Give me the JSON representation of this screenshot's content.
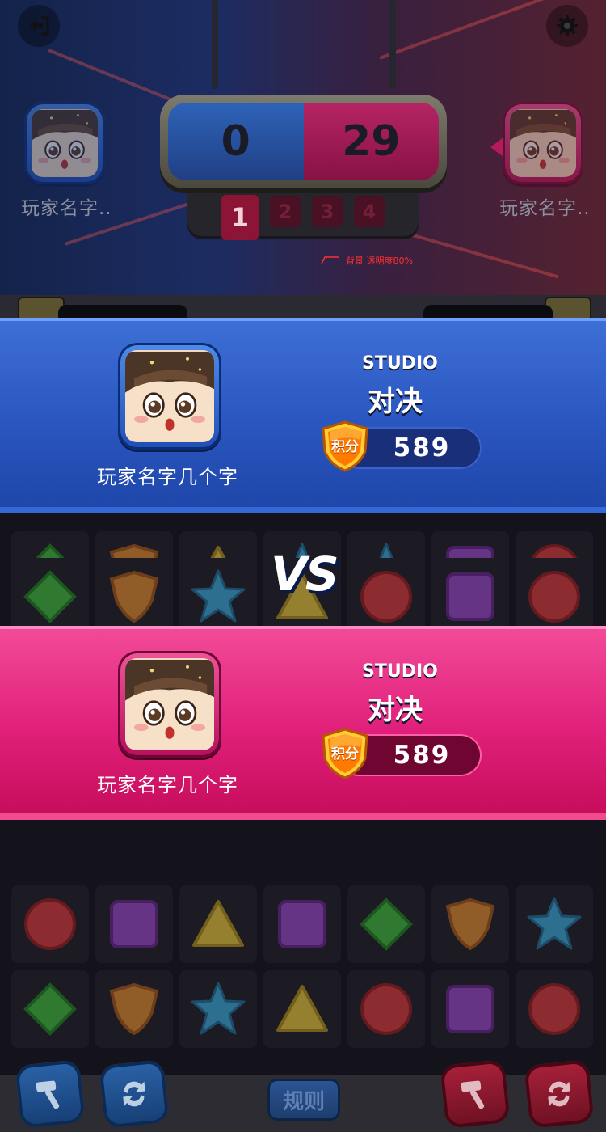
{
  "header": {
    "back_icon": "exit-arrow-icon",
    "settings_icon": "gear-icon",
    "left_player_name": "玩家名字..",
    "right_player_name": "玩家名字..",
    "annotation": "背景 透明度80%"
  },
  "scoreboard": {
    "blue_score": "0",
    "pink_score": "29",
    "rounds": [
      "1",
      "2",
      "3",
      "4"
    ],
    "active_round": "1"
  },
  "vs_overlay": {
    "vs_label": "VS",
    "blue_player": {
      "name": "玩家名字几个字",
      "studio_label": "STUDIO",
      "title": "对决",
      "badge_label": "积分",
      "points": "589"
    },
    "pink_player": {
      "name": "玩家名字几个字",
      "studio_label": "STUDIO",
      "title": "对决",
      "badge_label": "积分",
      "points": "589"
    }
  },
  "board": {
    "rows": [
      [
        "diamond-green",
        "shield-orange",
        "triangle-yellow",
        "star-blue",
        "star-blue",
        "square-purple",
        "circle-red"
      ],
      [
        "diamond-green",
        "shield-orange",
        "star-blue",
        "triangle-yellow",
        "circle-red",
        "square-purple",
        "circle-red"
      ],
      [
        "circle-red",
        "square-purple",
        "triangle-yellow",
        "square-purple",
        "diamond-green",
        "shield-orange",
        "star-blue"
      ],
      [
        "diamond-green",
        "shield-orange",
        "star-blue",
        "triangle-yellow",
        "circle-red",
        "square-purple",
        "circle-red"
      ]
    ]
  },
  "footer": {
    "rules_label": "规则",
    "left_tools": [
      "hammer-icon",
      "swap-icon"
    ],
    "right_tools": [
      "hammer-icon",
      "swap-icon"
    ]
  },
  "colors": {
    "blue_team": "#2a56bf",
    "pink_team": "#e0207a",
    "badge_orange": "#ff7a00"
  }
}
